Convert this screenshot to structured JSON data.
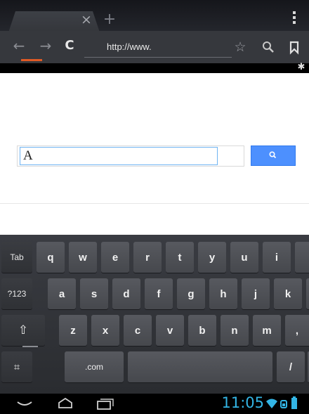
{
  "browser": {
    "url_value": "http://www.",
    "tab_close_glyph": "×",
    "new_tab_glyph": "+",
    "back_glyph": "←",
    "forward_glyph": "→",
    "reload_glyph": "C",
    "star_glyph": "☆",
    "gear_glyph": "✱"
  },
  "page": {
    "query_value": "A"
  },
  "keyboard": {
    "row1": [
      "Tab",
      "q",
      "w",
      "e",
      "r",
      "t",
      "y",
      "u",
      "i"
    ],
    "row2": [
      "?123",
      "a",
      "s",
      "d",
      "f",
      "g",
      "h",
      "j",
      "k"
    ],
    "row3": [
      "⇧",
      "z",
      "x",
      "c",
      "v",
      "b",
      "n",
      "m",
      ","
    ],
    "row4": [
      "⌗",
      ".com",
      "",
      "/"
    ]
  },
  "statusbar": {
    "time": "11:05",
    "accent_color": "#33b5e5"
  }
}
